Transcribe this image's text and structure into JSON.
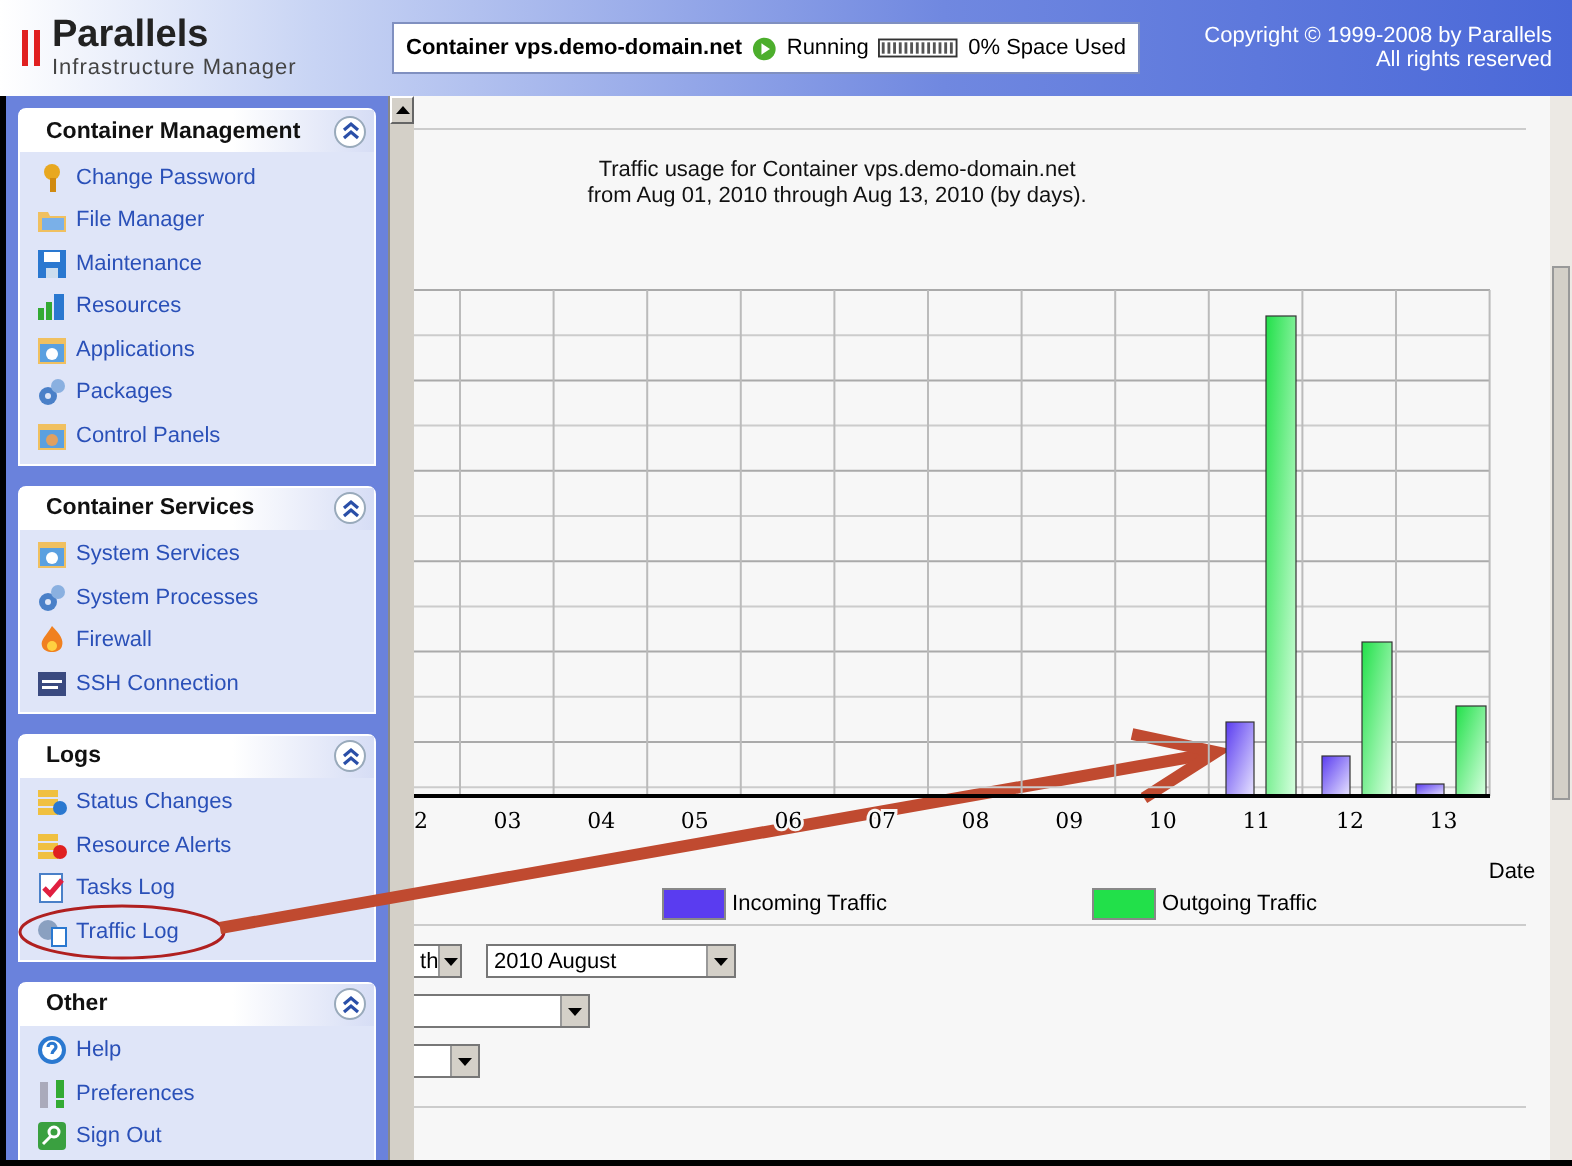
{
  "header": {
    "logo": {
      "name": "Parallels",
      "subtitle": "Infrastructure Manager"
    },
    "status": {
      "container": "Container vps.demo-domain.net",
      "state": "Running",
      "space": "0% Space Used"
    },
    "copyright": [
      "Copyright © 1999-2008 by Parallels",
      "All rights reserved"
    ]
  },
  "sidebar": {
    "sections": [
      {
        "title": "Container Management",
        "expanded": true,
        "items": [
          {
            "label": "Change Password"
          },
          {
            "label": "File Manager"
          },
          {
            "label": "Maintenance"
          },
          {
            "label": "Resources"
          },
          {
            "label": "Applications"
          },
          {
            "label": "Packages"
          },
          {
            "label": "Control Panels"
          }
        ]
      },
      {
        "title": "Container Services",
        "expanded": true,
        "items": [
          {
            "label": "System Services"
          },
          {
            "label": "System Processes"
          },
          {
            "label": "Firewall"
          },
          {
            "label": "SSH Connection"
          }
        ]
      },
      {
        "title": "Logs",
        "expanded": true,
        "items": [
          {
            "label": "Status Changes"
          },
          {
            "label": "Resource Alerts"
          },
          {
            "label": "Tasks Log"
          },
          {
            "label": "Traffic Log"
          }
        ]
      },
      {
        "title": "Other",
        "expanded": true,
        "items": [
          {
            "label": "Help"
          },
          {
            "label": "Preferences"
          },
          {
            "label": "Sign Out"
          }
        ]
      }
    ]
  },
  "content": {
    "title": [
      "Traffic usage for Container vps.demo-domain.net",
      "from Aug 01, 2010 through Aug 13, 2010 (by days)."
    ],
    "chart": {
      "x_labels": [
        "2",
        "03",
        "04",
        "05",
        "06",
        "07",
        "08",
        "09",
        "10",
        "11",
        "12",
        "13"
      ],
      "xlabel": "Date",
      "legend": [
        {
          "label": "Incoming Traffic",
          "color": "#5a3cf0"
        },
        {
          "label": "Outgoing Traffic",
          "color": "#22e04a"
        }
      ]
    },
    "filter_rows": [
      {
        "selects": [
          {
            "kind": "value",
            "value": "th"
          },
          {
            "kind": "value",
            "value": "2010 August"
          }
        ]
      },
      {
        "selects": [
          {
            "kind": "blank"
          }
        ]
      },
      {
        "selects": [
          {
            "kind": "blank"
          }
        ]
      }
    ]
  }
}
